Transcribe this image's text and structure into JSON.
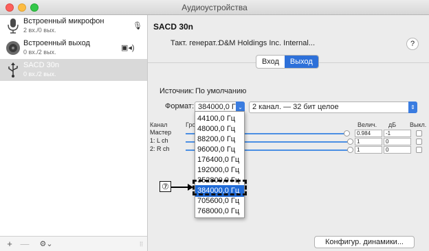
{
  "window": {
    "title": "Аудиоустройства"
  },
  "sidebar": {
    "devices": [
      {
        "name": "Встроенный микрофон",
        "channels": "2 вх./0 вых.",
        "icon": "microphone-icon",
        "badge": "mic-badge-icon"
      },
      {
        "name": "Встроенный выход",
        "channels": "0 вх./2 вых.",
        "icon": "speaker-icon",
        "badge": "display-speaker-icon"
      },
      {
        "name": "SACD 30n",
        "channels": "0 вх./2 вых.",
        "icon": "usb-icon",
        "selected": true
      }
    ],
    "bottom": {
      "add": "+",
      "remove": "—",
      "gear": "⚙⌄",
      "grip": "⁞⁞"
    }
  },
  "detail": {
    "device_title": "SACD 30n",
    "clock_label": "Такт. генерат.:",
    "clock_value": "D&M Holdings Inc. Internal...",
    "help": "?",
    "tabs": [
      {
        "label": "Вход",
        "active": false
      },
      {
        "label": "Выход",
        "active": true
      }
    ],
    "source_label": "Источник:",
    "source_value": "По умолчанию",
    "format_label": "Формат:",
    "format_value": "384000,0 Гц",
    "channel_format": "2 канал. — 32 бит целое",
    "table": {
      "headers": {
        "channel": "Канал",
        "vol": "Гро",
        "value": "Велич.",
        "db": "дБ",
        "mute": "Выкл."
      },
      "rows": [
        {
          "channel": "Мастер",
          "value": "0.984",
          "db": "-1"
        },
        {
          "channel": "1: L ch",
          "value": "1",
          "db": "0"
        },
        {
          "channel": "2: R ch",
          "value": "1",
          "db": "0"
        }
      ]
    },
    "sample_rates": [
      "44100,0 Гц",
      "48000,0 Гц",
      "88200,0 Гц",
      "96000,0 Гц",
      "176400,0 Гц",
      "192000,0 Гц",
      "352800,0 Гц",
      "384000,0 Гц",
      "705600,0 Гц",
      "768000,0 Гц"
    ],
    "selected_rate": "384000,0 Гц",
    "callout_number": "⑦",
    "configure_button": "Конфигур. динамики..."
  },
  "colors": {
    "accent": "#2d70d9",
    "selection": "#1f6ad6",
    "sidebar_selection": "#d9d9d9"
  }
}
